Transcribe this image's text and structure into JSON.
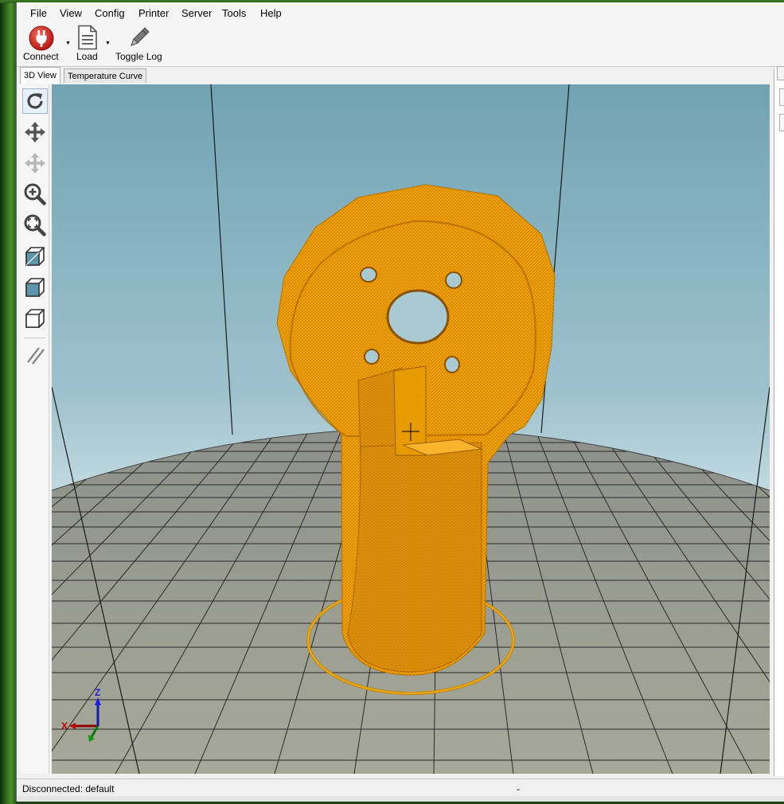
{
  "menu": {
    "items": [
      "File",
      "View",
      "Config",
      "Printer",
      "Server",
      "Tools",
      "Help"
    ]
  },
  "toolbar": {
    "connect_label": "Connect",
    "load_label": "Load",
    "toggle_log_label": "Toggle Log"
  },
  "tabs": {
    "view3d": "3D View",
    "temperature": "Temperature Curve"
  },
  "side_tools": [
    "rotate-icon",
    "move-icon",
    "move-object-icon",
    "zoom-icon",
    "fit-view-icon",
    "iso-view-icon",
    "front-view-icon",
    "top-view-icon",
    "slice-icon"
  ],
  "viewport": {
    "axis_x": "X",
    "axis_z": "Z",
    "model_color": "#f0a000",
    "bed_color": "#9b9e96",
    "sky_color": "#7aaab8"
  },
  "status": {
    "text": "Disconnected: default",
    "separator": "-"
  }
}
